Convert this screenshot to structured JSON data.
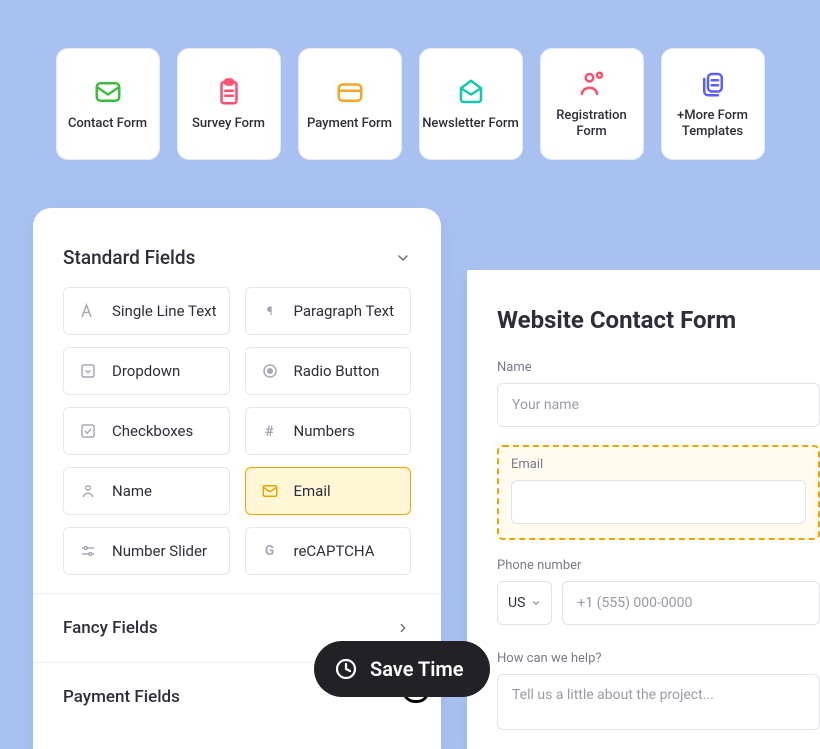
{
  "templates": [
    {
      "name": "contact-form",
      "label": "Contact Form",
      "color": "#3DBB3D",
      "icon": "mail"
    },
    {
      "name": "survey-form",
      "label": "Survey Form",
      "color": "#FF4D6D",
      "icon": "clipboard"
    },
    {
      "name": "payment-form",
      "label": "Payment Form",
      "color": "#F5A623",
      "icon": "card"
    },
    {
      "name": "newsletter-form",
      "label": "Newsletter Form",
      "color": "#0FC9A8",
      "icon": "envelope"
    },
    {
      "name": "registration-form",
      "label": "Registration Form",
      "color": "#FF4D6D",
      "icon": "user"
    },
    {
      "name": "more-templates",
      "label": "+More Form Templates",
      "color": "#5D5DFF",
      "icon": "copy"
    }
  ],
  "panel": {
    "section1_title": "Standard Fields",
    "section2_title": "Fancy Fields",
    "section3_title": "Payment Fields",
    "fields": [
      {
        "label": "Single Line Text",
        "icon": "A"
      },
      {
        "label": "Paragraph Text",
        "icon": "¶"
      },
      {
        "label": "Dropdown",
        "icon": "▾"
      },
      {
        "label": "Radio Button",
        "icon": "◉"
      },
      {
        "label": "Checkboxes",
        "icon": "☑"
      },
      {
        "label": "Numbers",
        "icon": "#"
      },
      {
        "label": "Name",
        "icon": "👤"
      },
      {
        "label": "Email",
        "icon": "mail",
        "highlight": true
      },
      {
        "label": "Number Slider",
        "icon": "⇆"
      },
      {
        "label": "reCAPTCHA",
        "icon": "G"
      }
    ]
  },
  "form": {
    "title": "Website Contact Form",
    "name_label": "Name",
    "name_placeholder": "Your name",
    "email_label": "Email",
    "phone_label": "Phone number",
    "phone_country": "US",
    "phone_placeholder": "+1 (555) 000-0000",
    "help_label": "How can we help?",
    "help_placeholder": "Tell us a little about the project..."
  },
  "pill_label": "Save Time"
}
